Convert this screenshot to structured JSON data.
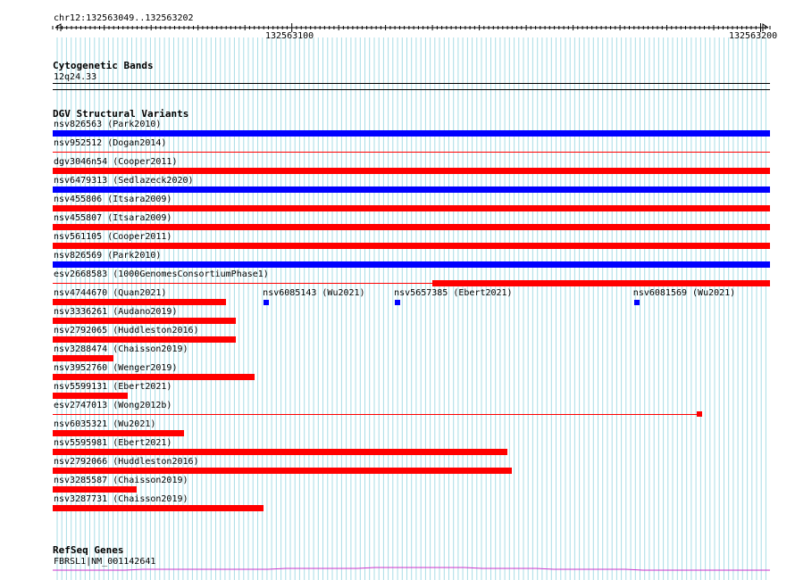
{
  "ruler": {
    "region": "chr12:132563049..132563202",
    "start": 132563049,
    "end": 132563202,
    "tick_labels": [
      "132563100",
      "132563200"
    ]
  },
  "cytoband": {
    "title": "Cytogenetic Bands",
    "label": "12q24.33"
  },
  "dgv": {
    "title": "DGV Structural Variants",
    "colors": {
      "loss": "#ff0000",
      "gain": "#0000ff"
    },
    "variants": [
      {
        "label": "nsv826563 (Park2010)",
        "color": "gain",
        "start": 132563049,
        "end": 132563202,
        "style": "thick"
      },
      {
        "label": "nsv952512 (Dogan2014)",
        "color": "loss",
        "start": 132563049,
        "end": 132563202,
        "style": "thin"
      },
      {
        "label": "dgv3046n54 (Cooper2011)",
        "color": "loss",
        "start": 132563049,
        "end": 132563202,
        "style": "thick"
      },
      {
        "label": "nsv6479313 (Sedlazeck2020)",
        "color": "gain",
        "start": 132563049,
        "end": 132563202,
        "style": "thick"
      },
      {
        "label": "nsv455806 (Itsara2009)",
        "color": "loss",
        "start": 132563049,
        "end": 132563202,
        "style": "thick"
      },
      {
        "label": "nsv455807 (Itsara2009)",
        "color": "loss",
        "start": 132563049,
        "end": 132563202,
        "style": "thick"
      },
      {
        "label": "nsv561105 (Cooper2011)",
        "color": "loss",
        "start": 132563049,
        "end": 132563202,
        "style": "thick"
      },
      {
        "label": "nsv826569 (Park2010)",
        "color": "gain",
        "start": 132563049,
        "end": 132563202,
        "style": "thick"
      },
      {
        "label": "esv2668583 (1000GenomesConsortiumPhase1)",
        "color": "loss",
        "start": 132563049,
        "end": 132563202,
        "style": "thin",
        "thick_from": 132563130
      },
      {
        "label": "nsv4744670 (Quan2021)",
        "color": "loss",
        "start": 132563049,
        "end": 132563086,
        "style": "thick"
      },
      {
        "label": "nsv3336261 (Audano2019)",
        "color": "loss",
        "start": 132563049,
        "end": 132563088,
        "style": "thick"
      },
      {
        "label": "nsv2792065 (Huddleston2016)",
        "color": "loss",
        "start": 132563049,
        "end": 132563088,
        "style": "thick"
      },
      {
        "label": "nsv3288474 (Chaisson2019)",
        "color": "loss",
        "start": 132563049,
        "end": 132563062,
        "style": "thick"
      },
      {
        "label": "nsv3952760 (Wenger2019)",
        "color": "loss",
        "start": 132563049,
        "end": 132563092,
        "style": "thick"
      },
      {
        "label": "nsv5599131 (Ebert2021)",
        "color": "loss",
        "start": 132563049,
        "end": 132563065,
        "style": "thick"
      },
      {
        "label": "esv2747013 (Wong2012b)",
        "color": "loss",
        "start": 132563049,
        "end": 132563187,
        "style": "thin",
        "end_box": true
      },
      {
        "label": "nsv6035321 (Wu2021)",
        "color": "loss",
        "start": 132563049,
        "end": 132563077,
        "style": "thick"
      },
      {
        "label": "nsv5595981 (Ebert2021)",
        "color": "loss",
        "start": 132563049,
        "end": 132563146,
        "style": "thick"
      },
      {
        "label": "nsv2792066 (Huddleston2016)",
        "color": "loss",
        "start": 132563049,
        "end": 132563147,
        "style": "thick"
      },
      {
        "label": "nsv3285587 (Chaisson2019)",
        "color": "loss",
        "start": 132563049,
        "end": 132563067,
        "style": "thick"
      },
      {
        "label": "nsv3287731 (Chaisson2019)",
        "color": "loss",
        "start": 132563049,
        "end": 132563094,
        "style": "thick"
      }
    ],
    "point_variants": [
      {
        "label": "nsv6085143 (Wu2021)",
        "color": "gain",
        "pos": 132563094,
        "row": 9
      },
      {
        "label": "nsv5657385 (Ebert2021)",
        "color": "gain",
        "pos": 132563122,
        "row": 9
      },
      {
        "label": "nsv6081569 (Wu2021)",
        "color": "gain",
        "pos": 132563173,
        "row": 9
      }
    ]
  },
  "refseq": {
    "title": "RefSeq Genes",
    "label": "FBRSL1|NM_001142641",
    "color": "#cc33cc"
  }
}
